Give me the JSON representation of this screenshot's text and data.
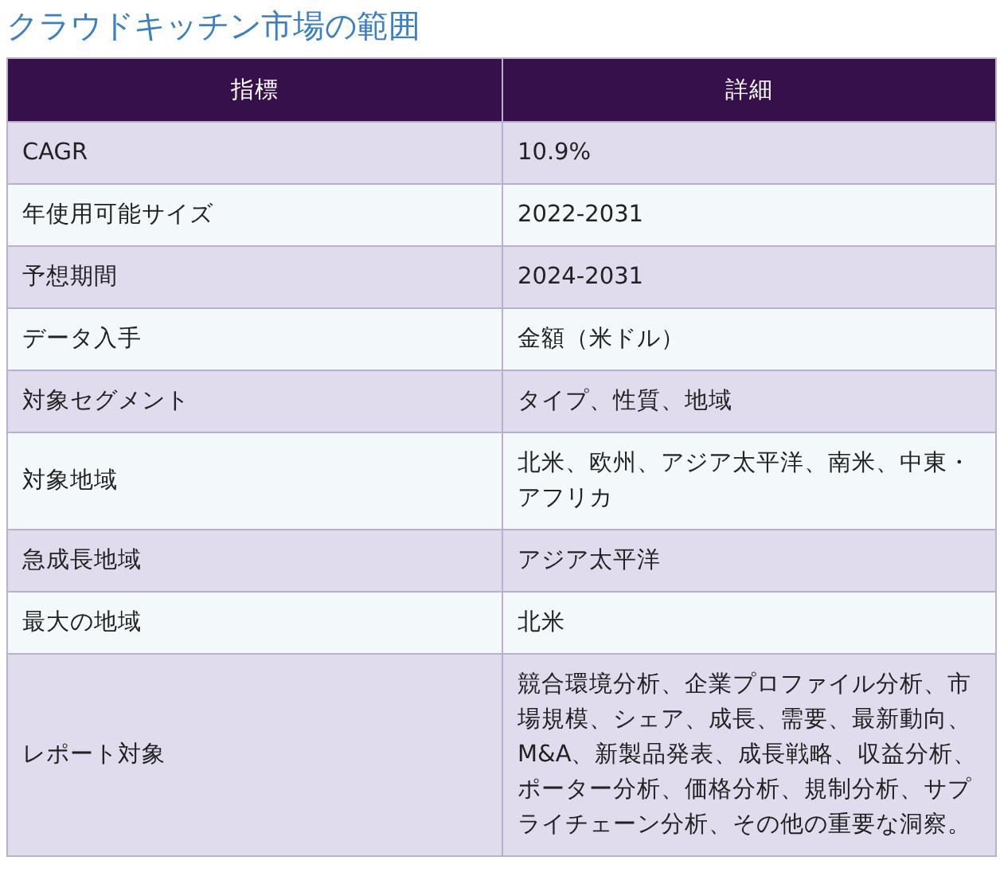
{
  "title": "クラウドキッチン市場の範囲",
  "table": {
    "columns": [
      "指標",
      "詳細"
    ],
    "rows": [
      {
        "metric": "CAGR",
        "detail": "10.9%"
      },
      {
        "metric": "年使用可能サイズ",
        "detail": "2022-2031"
      },
      {
        "metric": "予想期間",
        "detail": "2024-2031"
      },
      {
        "metric": "データ入手",
        "detail": "金額（米ドル）"
      },
      {
        "metric": "対象セグメント",
        "detail": "タイプ、性質、地域"
      },
      {
        "metric": "対象地域",
        "detail": "北米、欧州、アジア太平洋、南米、中東・アフリカ"
      },
      {
        "metric": "急成長地域",
        "detail": "アジア太平洋"
      },
      {
        "metric": "最大の地域",
        "detail": "北米"
      },
      {
        "metric": "レポート対象",
        "detail": "競合環境分析、企業プロファイル分析、市場規模、シェア、成長、需要、最新動向、M&A、新製品発表、成長戦略、収益分析、ポーター分析、価格分析、規制分析、サプライチェーン分析、その他の重要な洞察。"
      }
    ]
  }
}
